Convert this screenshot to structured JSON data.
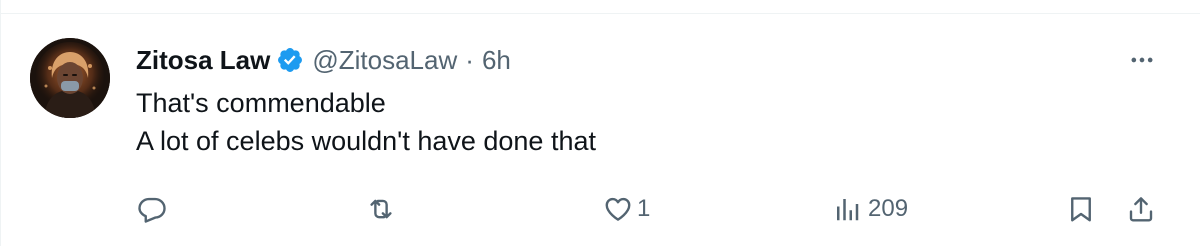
{
  "tweet": {
    "author": {
      "display_name": "Zitosa Law",
      "handle": "@ZitosaLaw",
      "verified": true,
      "avatar_icon": "avatar-portrait-icon"
    },
    "separator": "·",
    "timestamp": "6h",
    "text_lines": [
      "That's commendable",
      "A lot of celebs wouldn't have done that"
    ],
    "actions": {
      "reply": {
        "icon": "reply-icon",
        "count": ""
      },
      "repost": {
        "icon": "repost-icon",
        "count": ""
      },
      "like": {
        "icon": "heart-icon",
        "count": "1"
      },
      "views": {
        "icon": "views-icon",
        "count": "209"
      },
      "bookmark": {
        "icon": "bookmark-icon"
      },
      "share": {
        "icon": "share-icon"
      }
    }
  },
  "colors": {
    "text_primary": "#0f1419",
    "text_secondary": "#536471",
    "verified_blue": "#1d9bf0",
    "divider": "#eff3f4"
  }
}
